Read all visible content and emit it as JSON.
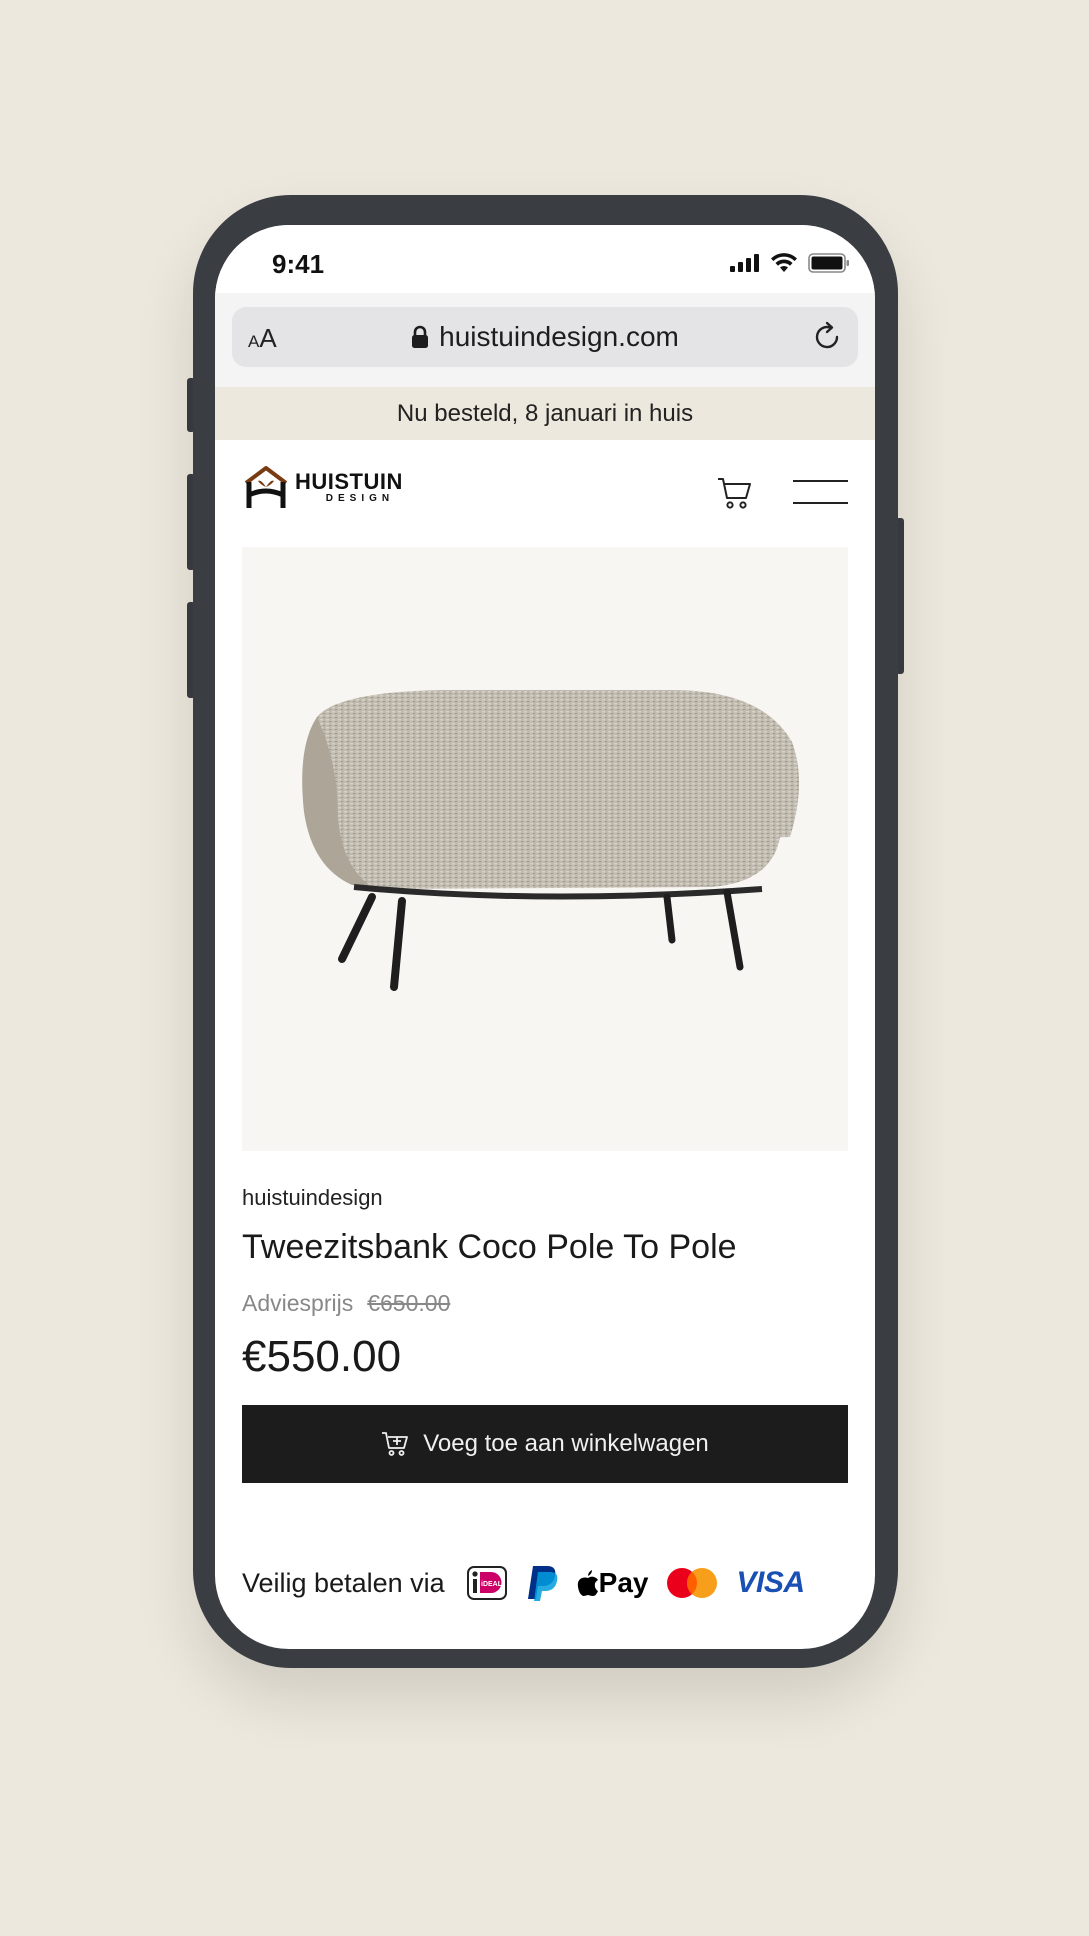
{
  "status_bar": {
    "time": "9:41"
  },
  "browser": {
    "url": "huistuindesign.com",
    "text_size_label": "A",
    "text_size_label_small": "A"
  },
  "announcement": {
    "text": "Nu besteld, 8 januari in huis"
  },
  "header": {
    "logo_main": "HUISTUIN",
    "logo_sub": "DESIGN"
  },
  "product": {
    "brand": "huistuindesign",
    "title": "Tweezitsbank Coco Pole To Pole",
    "advice_label": "Adviesprijs",
    "old_price": "€650.00",
    "price": "€550.00",
    "add_to_cart_label": "Voeg toe aan winkelwagen"
  },
  "payment": {
    "label": "Veilig betalen via",
    "methods": [
      "iDEAL",
      "PayPal",
      "Apple Pay",
      "Mastercard",
      "VISA"
    ],
    "applepay_text": "Pay",
    "visa_text": "VISA",
    "ideal_text": "iDEAL"
  },
  "colors": {
    "page_background": "#ede8dd",
    "phone_frame": "#3a3d42",
    "button_dark": "#1c1c1c",
    "visa_blue": "#1a4fb4",
    "ideal_pink": "#cc0066",
    "paypal_blue": "#003087",
    "mastercard_red": "#eb001b",
    "mastercard_orange": "#f79e1b",
    "logo_brown": "#7a3b12"
  }
}
